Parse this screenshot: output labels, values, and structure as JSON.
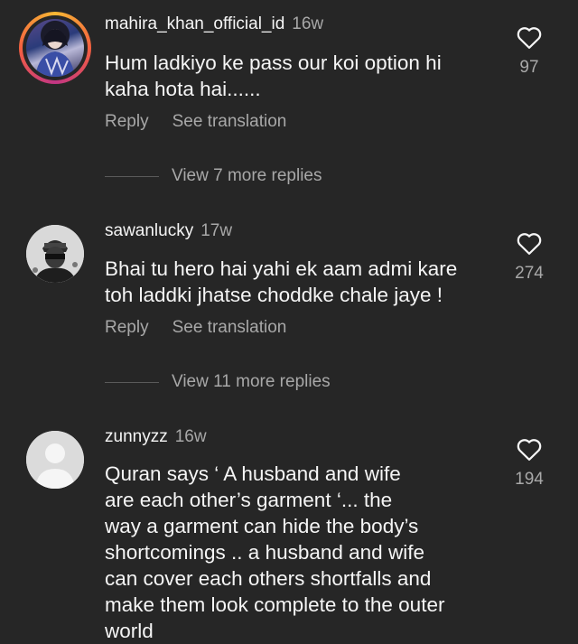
{
  "comments": [
    {
      "username": "mahira_khan_official_id",
      "age": "16w",
      "lines": [
        "Hum ladkiyo ke pass our koi option hi",
        "kaha hota hai......"
      ],
      "reply_label": "Reply",
      "translate_label": "See translation",
      "likes": "97",
      "view_more": "View 7 more replies",
      "avatar_icon": "profile-photo-story-ring"
    },
    {
      "username": "sawanlucky",
      "age": "17w",
      "lines": [
        "Bhai tu hero hai yahi ek aam admi kare",
        "toh laddki jhatse choddke chale jaye !"
      ],
      "reply_label": "Reply",
      "translate_label": "See translation",
      "likes": "274",
      "view_more": "View 11 more replies",
      "avatar_icon": "profile-photo"
    },
    {
      "username": "zunnyzz",
      "age": "16w",
      "lines": [
        "Quran says ‘ A husband and wife",
        "are each other’s garment ‘... the",
        "way a garment can hide the body’s",
        "shortcomings .. a husband and wife",
        "can cover each others shortfalls and",
        "make them look complete to the outer",
        "world"
      ],
      "likes": "194",
      "avatar_icon": "default-avatar"
    }
  ],
  "colors": {
    "background": "#262626",
    "primary_text": "#f5f5f5",
    "secondary_text": "#a8a8a8"
  }
}
